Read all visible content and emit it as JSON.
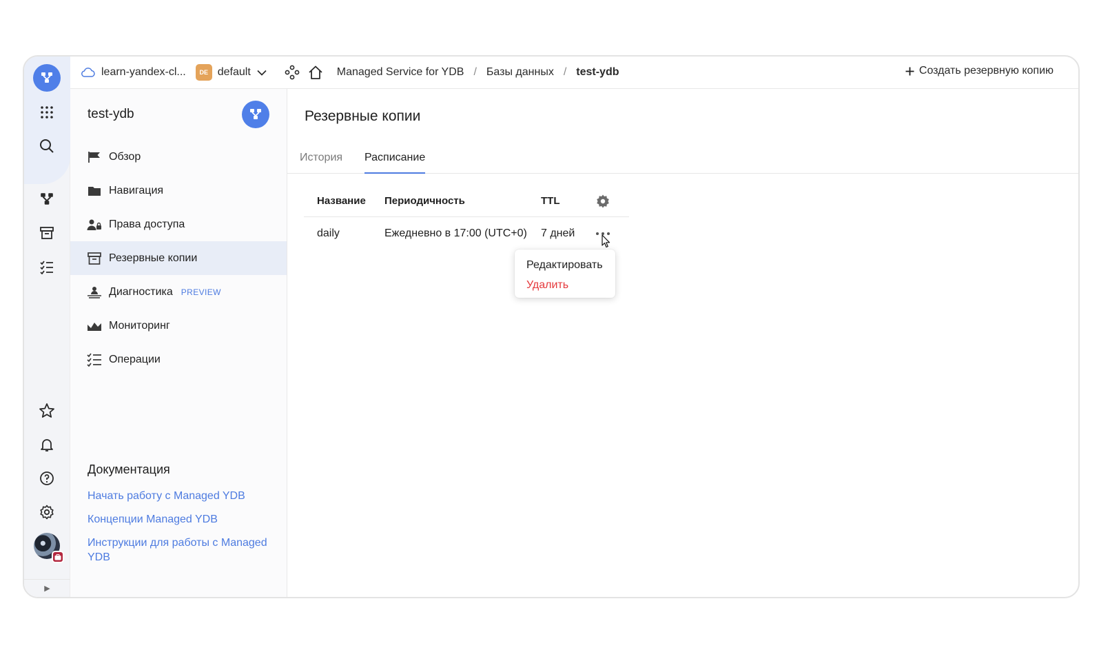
{
  "topbar": {
    "cloud_name": "learn-yandex-cl...",
    "folder_badge": "DE",
    "folder_name": "default",
    "breadcrumbs": [
      "Managed Service for YDB",
      "Базы данных",
      "test-ydb"
    ],
    "create_backup_label": "Создать резервную копию"
  },
  "sidebar": {
    "title": "test-ydb",
    "items": [
      {
        "label": "Обзор",
        "icon": "flag-icon"
      },
      {
        "label": "Навигация",
        "icon": "folder-icon"
      },
      {
        "label": "Права доступа",
        "icon": "users-lock-icon"
      },
      {
        "label": "Резервные копии",
        "icon": "archive-icon",
        "active": true
      },
      {
        "label": "Диагностика",
        "icon": "diagnostics-icon",
        "tag": "PREVIEW"
      },
      {
        "label": "Мониторинг",
        "icon": "chart-icon"
      },
      {
        "label": "Операции",
        "icon": "list-check-icon"
      }
    ],
    "docs": {
      "title": "Документация",
      "links": [
        "Начать работу с Managed YDB",
        "Концепции Managed YDB",
        "Инструкции для работы с Managed YDB"
      ]
    }
  },
  "main": {
    "title": "Резервные копии",
    "tabs": [
      {
        "label": "История",
        "active": false
      },
      {
        "label": "Расписание",
        "active": true
      }
    ],
    "table": {
      "columns": [
        "Название",
        "Периодичность",
        "TTL"
      ],
      "rows": [
        {
          "name": "daily",
          "period": "Ежедневно в 17:00 (UTC+0)",
          "ttl": "7 дней"
        }
      ]
    },
    "menu": {
      "items": [
        "Редактировать",
        "Удалить"
      ]
    }
  },
  "colors": {
    "accent": "#4d7be0",
    "danger": "#e5383b",
    "brand": "#4f7fe8",
    "folder_badge": "#e4a35a"
  }
}
